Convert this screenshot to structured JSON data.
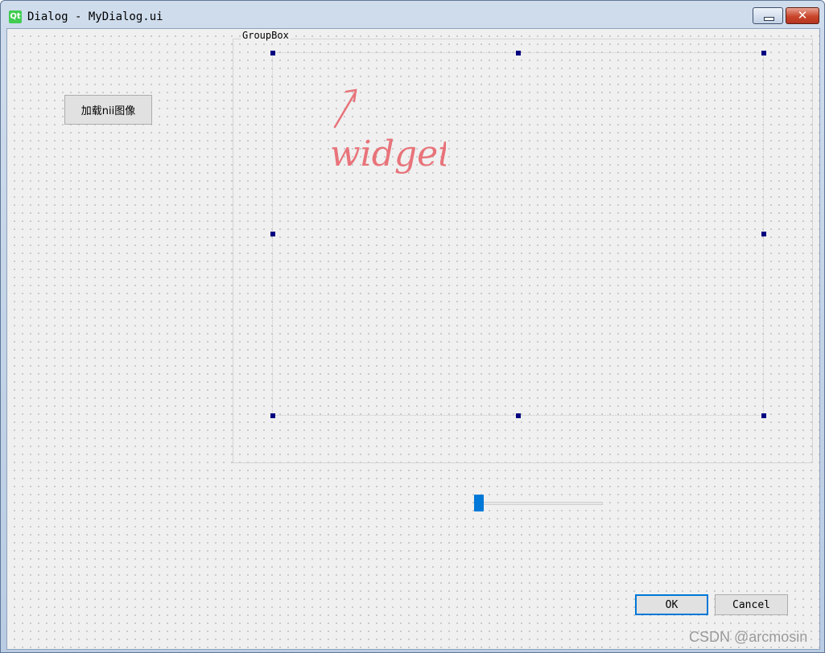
{
  "window": {
    "title": "Dialog - MyDialog.ui",
    "logo_text": "Qt",
    "minimize_icon": "minimize-icon",
    "close_icon": "close-icon",
    "close_glyph": "✕"
  },
  "dialog": {
    "load_button_label": "加载nii图像",
    "groupbox_title": "GroupBox",
    "annotation_text": "widget",
    "slider": {
      "value_fraction": 0.0
    },
    "ok_label": "OK",
    "cancel_label": "Cancel"
  },
  "watermark": "CSDN @arcmosin",
  "colors": {
    "selection_handle": "#000080",
    "slider_handle": "#0078d7",
    "annotation": "#e8737a"
  }
}
